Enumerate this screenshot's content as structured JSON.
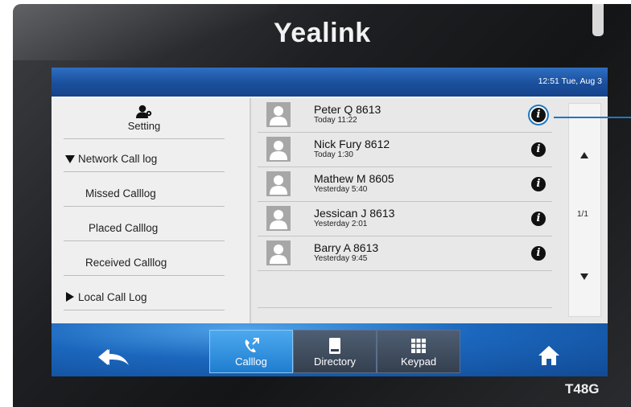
{
  "device": {
    "brand": "Yealink",
    "model": "T48G"
  },
  "status_bar": {
    "datetime": "12:51 Tue, Aug 3"
  },
  "left_menu": {
    "setting_label": "Setting",
    "items": [
      {
        "label": "Network Call log",
        "expanded": true
      },
      {
        "label": "Missed Calllog"
      },
      {
        "label": "Placed Calllog"
      },
      {
        "label": "Received Calllog"
      },
      {
        "label": "Local Call Log",
        "expanded": false
      }
    ]
  },
  "call_list": [
    {
      "name": "Peter Q 8613",
      "time": "Today 11:22"
    },
    {
      "name": "Nick Fury 8612",
      "time": "Today 1:30"
    },
    {
      "name": "Mathew M 8605",
      "time": "Yesterday 5:40"
    },
    {
      "name": "Jessican J 8613",
      "time": "Yesterday 2:01"
    },
    {
      "name": "Barry A 8613",
      "time": "Yesterday 9:45"
    }
  ],
  "pagination": {
    "label": "1/1"
  },
  "softkeys": [
    {
      "label": "Calllog",
      "icon": "calllog-icon",
      "active": true
    },
    {
      "label": "Directory",
      "icon": "directory-icon",
      "active": false
    },
    {
      "label": "Keypad",
      "icon": "keypad-icon",
      "active": false
    }
  ],
  "colors": {
    "accent": "#1d78c4",
    "status_bar": "#1b4f9c",
    "active_tab": "#2f92e0"
  }
}
